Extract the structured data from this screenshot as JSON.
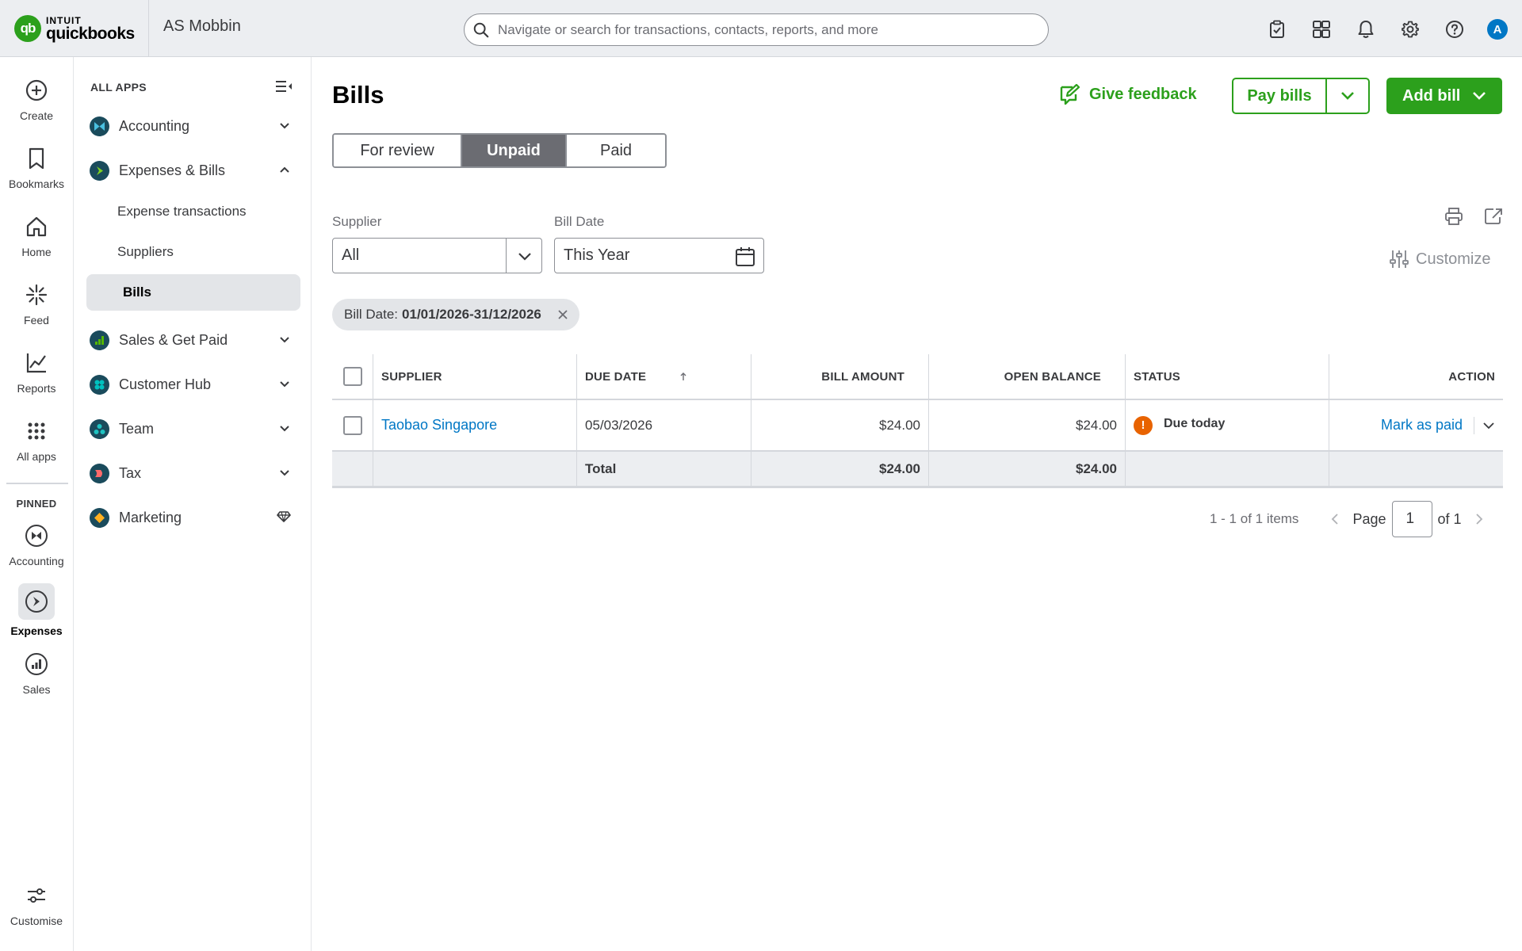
{
  "brand": {
    "logo_mark": "qb",
    "logo_top": "INTUIT",
    "logo_bottom": "quickbooks",
    "accent": "#2ca01c",
    "link": "#0077c5"
  },
  "company": "AS Mobbin",
  "search": {
    "placeholder": "Navigate or search for transactions, contacts, reports, and more"
  },
  "top_icons": [
    "checklist-icon",
    "apps-switcher-icon",
    "bell-icon",
    "gear-icon",
    "help-icon"
  ],
  "avatar": "A",
  "rail": {
    "items": [
      {
        "label": "Create",
        "icon": "plus-circle-icon"
      },
      {
        "label": "Bookmarks",
        "icon": "bookmark-icon"
      },
      {
        "label": "Home",
        "icon": "home-icon"
      },
      {
        "label": "Feed",
        "icon": "sparkle-icon"
      },
      {
        "label": "Reports",
        "icon": "line-chart-icon"
      },
      {
        "label": "All apps",
        "icon": "grid-dots-icon"
      }
    ],
    "pinned_label": "PINNED",
    "pinned": [
      {
        "label": "Accounting",
        "icon": "accounting-icon"
      },
      {
        "label": "Expenses",
        "icon": "expenses-icon"
      },
      {
        "label": "Sales",
        "icon": "sales-icon"
      }
    ],
    "customise": "Customise"
  },
  "nav": {
    "heading": "ALL APPS",
    "items": [
      {
        "label": "Accounting",
        "color": "#4ac0e0"
      },
      {
        "label": "Expenses & Bills",
        "color": "#7ed321"
      },
      {
        "label": "Sales & Get Paid",
        "color": "#53b700"
      },
      {
        "label": "Customer Hub",
        "color": "#00c1bf"
      },
      {
        "label": "Team",
        "color": "#1ec3c1"
      },
      {
        "label": "Tax",
        "color": "#ff6a6a"
      },
      {
        "label": "Marketing",
        "color": "#ffb020"
      }
    ],
    "sub_items": [
      "Expense transactions",
      "Suppliers",
      "Bills"
    ]
  },
  "page": {
    "title": "Bills",
    "feedback": "Give feedback",
    "pay_bills": "Pay bills",
    "add_bill": "Add bill",
    "tabs": [
      "For review",
      "Unpaid",
      "Paid"
    ],
    "active_tab": "Unpaid"
  },
  "filters": {
    "supplier_label": "Supplier",
    "supplier_value": "All",
    "date_label": "Bill Date",
    "date_value": "This Year",
    "customize": "Customize",
    "chip_label": "Bill Date:",
    "chip_value": "01/01/2026-31/12/2026"
  },
  "table": {
    "columns": [
      "SUPPLIER",
      "DUE DATE",
      "BILL AMOUNT",
      "OPEN BALANCE",
      "STATUS",
      "ACTION"
    ],
    "rows": [
      {
        "supplier": "Taobao Singapore",
        "due_date": "05/03/2026",
        "bill_amount": "$24.00",
        "open_balance": "$24.00",
        "status": "Due today",
        "status_mark": "!",
        "action": "Mark as paid"
      }
    ],
    "total": {
      "label": "Total",
      "bill_amount": "$24.00",
      "open_balance": "$24.00"
    }
  },
  "pager": {
    "range": "1 - 1 of 1 items",
    "page_label": "Page",
    "page": "1",
    "of": "of 1"
  }
}
